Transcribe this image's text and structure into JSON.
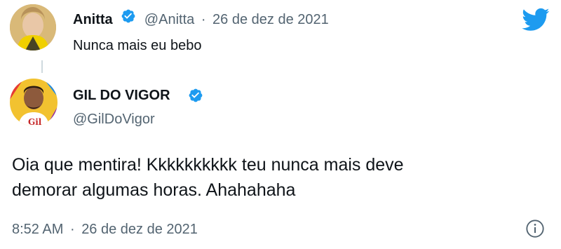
{
  "parent_tweet": {
    "display_name": "Anitta",
    "handle": "@Anitta",
    "separator": "·",
    "date": "26 de dez de 2021",
    "text": "Nunca mais eu bebo"
  },
  "reply_tweet": {
    "display_name": "GIL DO VIGOR",
    "handle": "@GilDoVigor",
    "text_line1": "Oia que mentira! Kkkkkkkkkk teu nunca mais deve",
    "text_line2": "demorar algumas horas. Ahahahaha",
    "time": "8:52 AM",
    "separator": "·",
    "date": "26 de dez de 2021"
  },
  "icons": {
    "brand": "twitter-bird-icon",
    "verified": "verified-badge-icon",
    "info": "info-icon"
  },
  "colors": {
    "brand": "#1d9bf0",
    "text": "#0f1419",
    "muted": "#536471",
    "thread_line": "#cfd9de"
  }
}
